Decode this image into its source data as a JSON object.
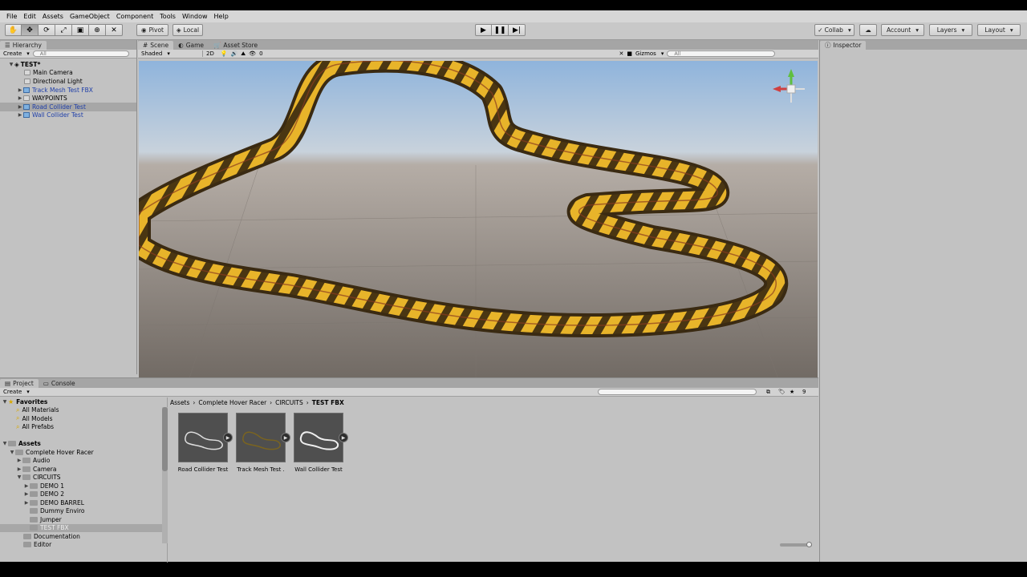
{
  "menu": [
    "File",
    "Edit",
    "Assets",
    "GameObject",
    "Component",
    "Tools",
    "Window",
    "Help"
  ],
  "toolbar": {
    "pivot": "Pivot",
    "local": "Local",
    "collab": "Collab",
    "account": "Account",
    "layers": "Layers",
    "layout": "Layout"
  },
  "hierarchy": {
    "tab": "Hierarchy",
    "create": "Create",
    "search_placeholder": "All",
    "scene_name": "TEST*",
    "items": [
      {
        "label": "Main Camera"
      },
      {
        "label": "Directional Light"
      },
      {
        "label": "Track Mesh Test FBX"
      },
      {
        "label": "WAYPOINTS"
      },
      {
        "label": "Road Collider Test"
      },
      {
        "label": "Wall Collider Test"
      }
    ]
  },
  "scene_view": {
    "tabs": [
      "Scene",
      "Game",
      "Asset Store"
    ],
    "shading": "Shaded",
    "mode_2d": "2D",
    "fx_count": "0",
    "gizmos": "Gizmos",
    "search_placeholder": "All"
  },
  "inspector": {
    "tab": "Inspector"
  },
  "project": {
    "tabs": [
      "Project",
      "Console"
    ],
    "create": "Create",
    "favorites_header": "Favorites",
    "favorites": [
      "All Materials",
      "All Models",
      "All Prefabs"
    ],
    "assets_header": "Assets",
    "folders": [
      {
        "label": "Complete Hover Racer"
      },
      {
        "label": "Audio"
      },
      {
        "label": "Camera"
      },
      {
        "label": "CIRCUITS"
      },
      {
        "label": "DEMO 1"
      },
      {
        "label": "DEMO 2"
      },
      {
        "label": "DEMO BARREL"
      },
      {
        "label": "Dummy Enviro"
      },
      {
        "label": "Jumper"
      },
      {
        "label": "TEST FBX"
      },
      {
        "label": "Documentation"
      },
      {
        "label": "Editor"
      }
    ],
    "breadcrumb": [
      "Assets",
      "Complete Hover Racer",
      "CIRCUITS",
      "TEST FBX"
    ],
    "assets": [
      {
        "label": "Road Collider Test"
      },
      {
        "label": "Track Mesh Test ."
      },
      {
        "label": "Wall Collider Test"
      }
    ],
    "count": "9"
  },
  "colors": {
    "selection": "#a7a7a7",
    "link_blue": "#1e3ea8",
    "track_yellow": "#e8b42a",
    "track_dark": "#3a2a12"
  }
}
